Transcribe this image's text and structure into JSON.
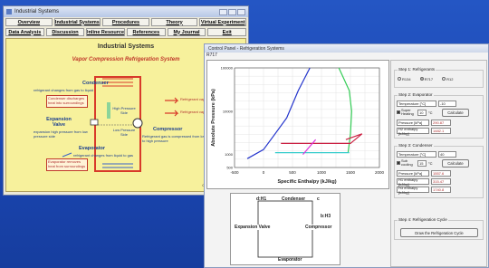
{
  "window1": {
    "title": "Industrial Systems",
    "menu_row1": [
      "Overview",
      "Industrial Systems",
      "Procedures",
      "Theory",
      "Virtual Experiment"
    ],
    "menu_row2": [
      "Data Analysis",
      "Discussion",
      "Online Resources",
      "References",
      "My Journal",
      "Exit"
    ],
    "content_title": "Industrial Systems",
    "subtitle": "Vapor Compression Refrigeration System",
    "condenser": "Condenser",
    "condenser_desc": "refrigerant changes from gas to liquid",
    "condenser_discharge": "Condenser discharges heat into surroundings",
    "expansion": "Expansion Valve",
    "expansion_desc": "expansion high pressure from low pressure side",
    "evaporator": "Evaporator",
    "evaporator_desc": "refrigerant changes from liquid to gas",
    "evaporator_remove": "Evaporator removes heat from surroundings",
    "compressor": "Compressor",
    "compressor_desc": "Refrigerant gas is compressed from low to high pressure",
    "high_pressure": "High Pressure Side",
    "low_pressure": "Low Pressure Side",
    "hot_label": "Refrigerant vapor/liquid",
    "cold_label": "Refrigerant vapor/liquid",
    "copyright": "Copyright: R. Paul Singh"
  },
  "window2": {
    "title": "Control Panel - Refrigeration Systems",
    "refrigerant_label": "R717"
  },
  "chart_data": {
    "type": "line",
    "xlabel": "Specific Enthalpy (kJ/kg)",
    "ylabel": "Absolute Pressure (kPa)",
    "xlim": [
      -500,
      2000
    ],
    "ylim_log": [
      500,
      100000
    ],
    "x_ticks": [
      "-500",
      "0",
      "500",
      "1000",
      "1500",
      "2000"
    ],
    "y_ticks": [
      "100000",
      "10000",
      "1000",
      "500"
    ],
    "series": [
      {
        "color": "#2233cc",
        "points": [
          [
            -280,
            800
          ],
          [
            0,
            1300
          ],
          [
            200,
            3000
          ],
          [
            400,
            7000
          ],
          [
            600,
            30000
          ],
          [
            800,
            100000
          ]
        ]
      },
      {
        "color": "#33cc55",
        "points": [
          [
            1300,
            100000
          ],
          [
            1480,
            30000
          ],
          [
            1520,
            10000
          ],
          [
            1500,
            3000
          ],
          [
            1460,
            1100
          ]
        ]
      },
      {
        "color": "#cc2244",
        "points": [
          [
            300,
            1800
          ],
          [
            1500,
            1800
          ],
          [
            1700,
            3000
          ],
          [
            1420,
            2200
          ]
        ]
      },
      {
        "color": "#33cccc",
        "points": [
          [
            200,
            1100
          ],
          [
            1480,
            1100
          ]
        ]
      },
      {
        "color": "#dd33dd",
        "points": [
          [
            680,
            1000
          ],
          [
            900,
            2200
          ]
        ]
      }
    ]
  },
  "panel": {
    "step1_title": "Step 1: Refrigerants",
    "refrigerants": [
      "R134",
      "R717",
      "R12"
    ],
    "step2_title": "Step 2: Evaporator",
    "evap_temp_label": "Temperature [°C]",
    "evap_temp_value": "-10",
    "superheat_label": "Super Heating",
    "superheat_value": "10",
    "unit_c": "°C",
    "calculate": "Calculate",
    "evap_pressure_label": "Pressure [kPa]",
    "evap_pressure_value": "290.87",
    "h2_label": "H2 enthalpy [kJ/kg]",
    "h2_value": "1482.1",
    "step3_title": "Step 3: Condenser",
    "cond_temp_label": "Temperature [°C]",
    "cond_temp_value": "40",
    "subcool_label": "Sub cooling",
    "subcool_value": "15",
    "cond_pressure_label": "Pressure [kPa]",
    "cond_pressure_value": "1557.6",
    "h1_label": "H1 enthalpy [kJ/kg]",
    "h1_value": "315.47",
    "h3_label": "H3 enthalpy [kJ/kg]",
    "h3_value": "1740.8",
    "step4_title": "Step 4: Refrigeration Cycle",
    "draw_button": "Draw the Refrigeration Cycle"
  },
  "cycle": {
    "d_h1": "d:H1",
    "condenser": "Condenser",
    "c": "c",
    "b_h3": "b:H3",
    "expansion_valve": "Expansion Valve",
    "compressor": "Compressor",
    "evaporator": "Evaporator"
  }
}
